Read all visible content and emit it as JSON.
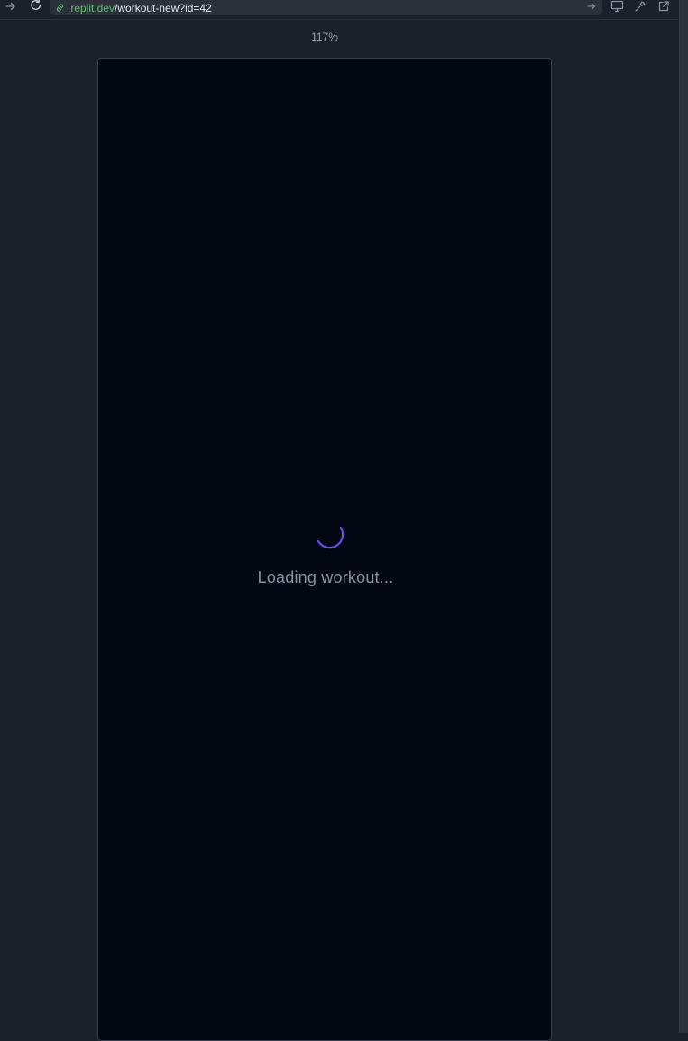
{
  "browser": {
    "url_host": ".replit.dev",
    "url_path": "/workout-new?id=42",
    "zoom_label": "117%",
    "icons": {
      "forward": "arrow-right-icon",
      "reload": "reload-icon",
      "secure": "link-icon",
      "go": "arrow-right-icon",
      "devices": "monitor-icon",
      "devtools": "wrench-icon",
      "open_new": "external-link-icon"
    },
    "colors": {
      "host_text": "#58c36c",
      "background": "#1c202a",
      "frame": "#020711"
    }
  },
  "app": {
    "loading_text": "Loading workout...",
    "spinner_color": "#6c4df2"
  }
}
